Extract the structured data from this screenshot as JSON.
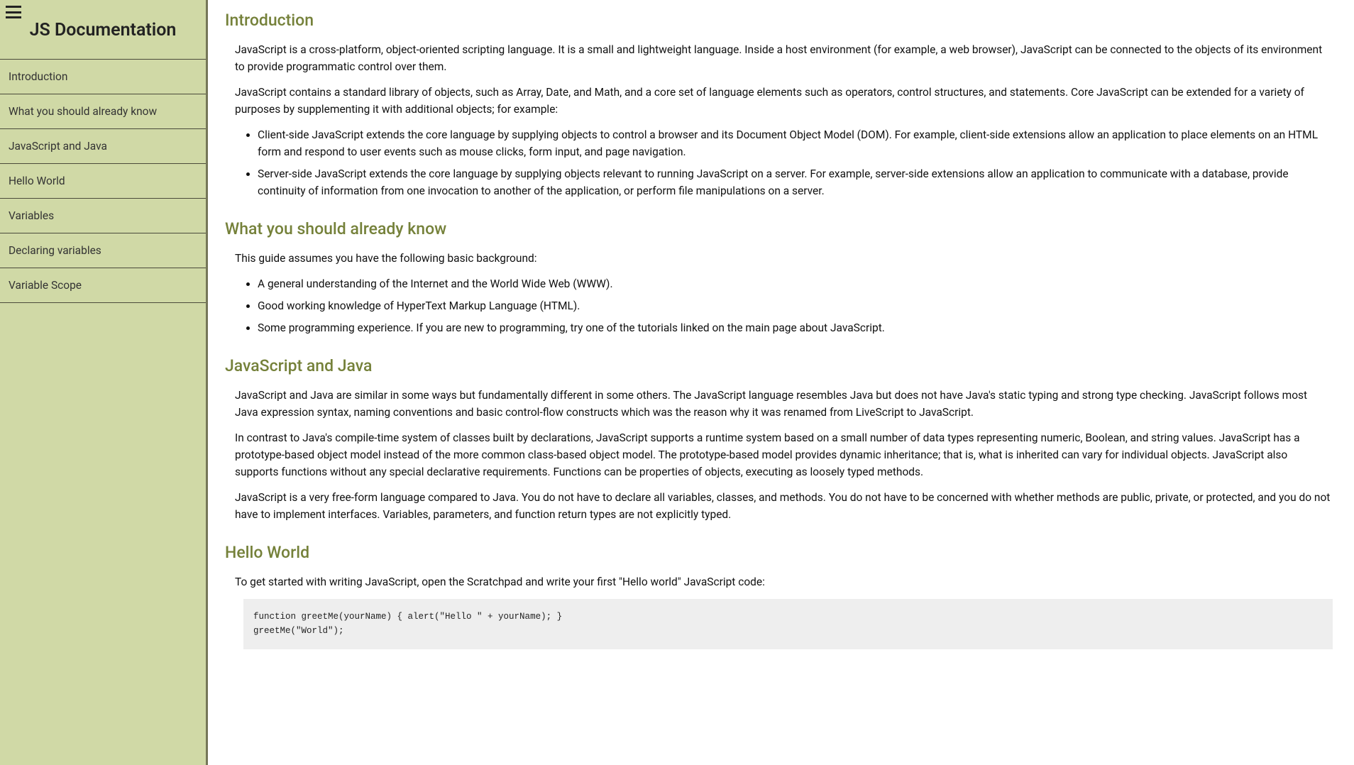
{
  "sidebar": {
    "title": "JS Documentation",
    "nav": [
      "Introduction",
      "What you should already know",
      "JavaScript and Java",
      "Hello World",
      "Variables",
      "Declaring variables",
      "Variable Scope"
    ]
  },
  "sections": {
    "introduction": {
      "header": "Introduction",
      "p1": "JavaScript is a cross-platform, object-oriented scripting language. It is a small and lightweight language. Inside a host environment (for example, a web browser), JavaScript can be connected to the objects of its environment to provide programmatic control over them.",
      "p2": "JavaScript contains a standard library of objects, such as Array, Date, and Math, and a core set of language elements such as operators, control structures, and statements. Core JavaScript can be extended for a variety of purposes by supplementing it with additional objects; for example:",
      "li1": "Client-side JavaScript extends the core language by supplying objects to control a browser and its Document Object Model (DOM). For example, client-side extensions allow an application to place elements on an HTML form and respond to user events such as mouse clicks, form input, and page navigation.",
      "li2": "Server-side JavaScript extends the core language by supplying objects relevant to running JavaScript on a server. For example, server-side extensions allow an application to communicate with a database, provide continuity of information from one invocation to another of the application, or perform file manipulations on a server."
    },
    "already_know": {
      "header": "What you should already know",
      "p1": "This guide assumes you have the following basic background:",
      "li1": "A general understanding of the Internet and the World Wide Web (WWW).",
      "li2": "Good working knowledge of HyperText Markup Language (HTML).",
      "li3": "Some programming experience. If you are new to programming, try one of the tutorials linked on the main page about JavaScript."
    },
    "js_and_java": {
      "header": "JavaScript and Java",
      "p1": "JavaScript and Java are similar in some ways but fundamentally different in some others. The JavaScript language resembles Java but does not have Java's static typing and strong type checking. JavaScript follows most Java expression syntax, naming conventions and basic control-flow constructs which was the reason why it was renamed from LiveScript to JavaScript.",
      "p2": "In contrast to Java's compile-time system of classes built by declarations, JavaScript supports a runtime system based on a small number of data types representing numeric, Boolean, and string values. JavaScript has a prototype-based object model instead of the more common class-based object model. The prototype-based model provides dynamic inheritance; that is, what is inherited can vary for individual objects. JavaScript also supports functions without any special declarative requirements. Functions can be properties of objects, executing as loosely typed methods.",
      "p3": "JavaScript is a very free-form language compared to Java. You do not have to declare all variables, classes, and methods. You do not have to be concerned with whether methods are public, private, or protected, and you do not have to implement interfaces. Variables, parameters, and function return types are not explicitly typed."
    },
    "hello_world": {
      "header": "Hello World",
      "p1": "To get started with writing JavaScript, open the Scratchpad and write your first \"Hello world\" JavaScript code:",
      "code": "function greetMe(yourName) { alert(\"Hello \" + yourName); }\ngreetMe(\"World\");"
    }
  }
}
